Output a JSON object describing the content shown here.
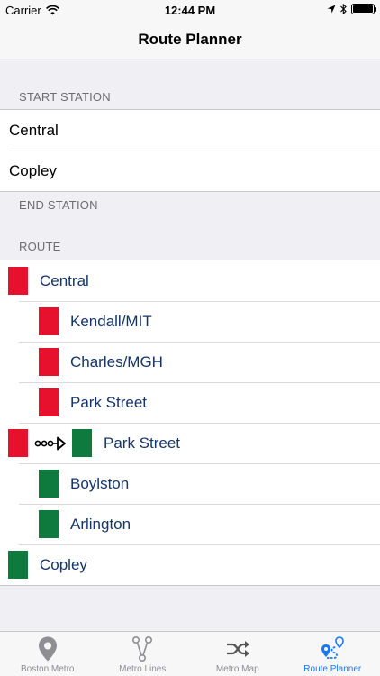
{
  "status_bar": {
    "carrier": "Carrier",
    "time": "12:44 PM"
  },
  "nav": {
    "title": "Route Planner"
  },
  "start_section": {
    "header": "START STATION",
    "items": [
      "Central",
      "Copley"
    ]
  },
  "end_section": {
    "header": "END STATION"
  },
  "route_section": {
    "header": "ROUTE",
    "steps": [
      {
        "label": "Central",
        "line_color": "#e8112d"
      },
      {
        "label": "Kendall/MIT",
        "line_color": "#e8112d"
      },
      {
        "label": "Charles/MGH",
        "line_color": "#e8112d"
      },
      {
        "label": "Park Street",
        "line_color": "#e8112d"
      },
      {
        "label": "Park Street",
        "from_color": "#e8112d",
        "line_color": "#0e7a3e"
      },
      {
        "label": "Boylston",
        "line_color": "#0e7a3e"
      },
      {
        "label": "Arlington",
        "line_color": "#0e7a3e"
      },
      {
        "label": "Copley",
        "line_color": "#0e7a3e"
      }
    ]
  },
  "tab_bar": {
    "tabs": [
      {
        "label": "Boston Metro",
        "icon": "map-pin-icon"
      },
      {
        "label": "Metro Lines",
        "icon": "branch-icon"
      },
      {
        "label": "Metro Map",
        "icon": "shuffle-icon"
      },
      {
        "label": "Route Planner",
        "icon": "route-icon",
        "active": true
      }
    ]
  },
  "colors": {
    "accent": "#1878f6",
    "red_line": "#e8112d",
    "green_line": "#0e7a3e",
    "station_text": "#14356b"
  }
}
